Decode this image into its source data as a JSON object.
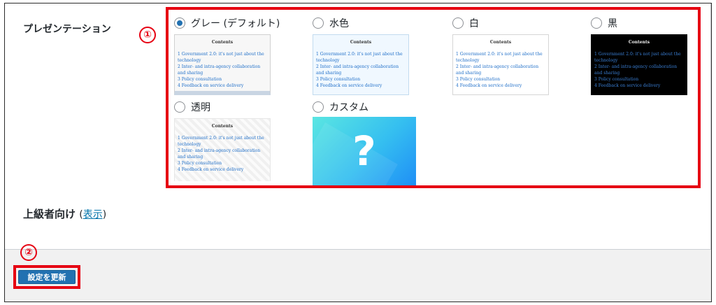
{
  "presentation_label": "プレゼンテーション",
  "advanced": {
    "label": "上級者向け",
    "open_paren": "(",
    "link": "表示",
    "close_paren": ")"
  },
  "badges": {
    "themes": "①",
    "save": "②"
  },
  "options": [
    {
      "id": "gray",
      "label": "グレー (デフォルト)",
      "checked": true
    },
    {
      "id": "aqua",
      "label": "水色",
      "checked": false
    },
    {
      "id": "white",
      "label": "白",
      "checked": false
    },
    {
      "id": "black",
      "label": "黒",
      "checked": false
    },
    {
      "id": "transparent",
      "label": "透明",
      "checked": false
    },
    {
      "id": "custom",
      "label": "カスタム",
      "checked": false
    }
  ],
  "preview": {
    "title": "Contents",
    "items": [
      "1 Government 2.0: it's not just about the technology",
      "2 Inter- and intra-agency collaboration and sharing",
      "3 Policy consultation",
      "4 Feedback on service delivery"
    ]
  },
  "custom_symbol": "?",
  "save_button": "設定を更新",
  "colors": {
    "accent_red": "#e60012",
    "button_blue": "#2271b1",
    "link_blue": "#1e6ec8",
    "black_preview": "#000000"
  }
}
